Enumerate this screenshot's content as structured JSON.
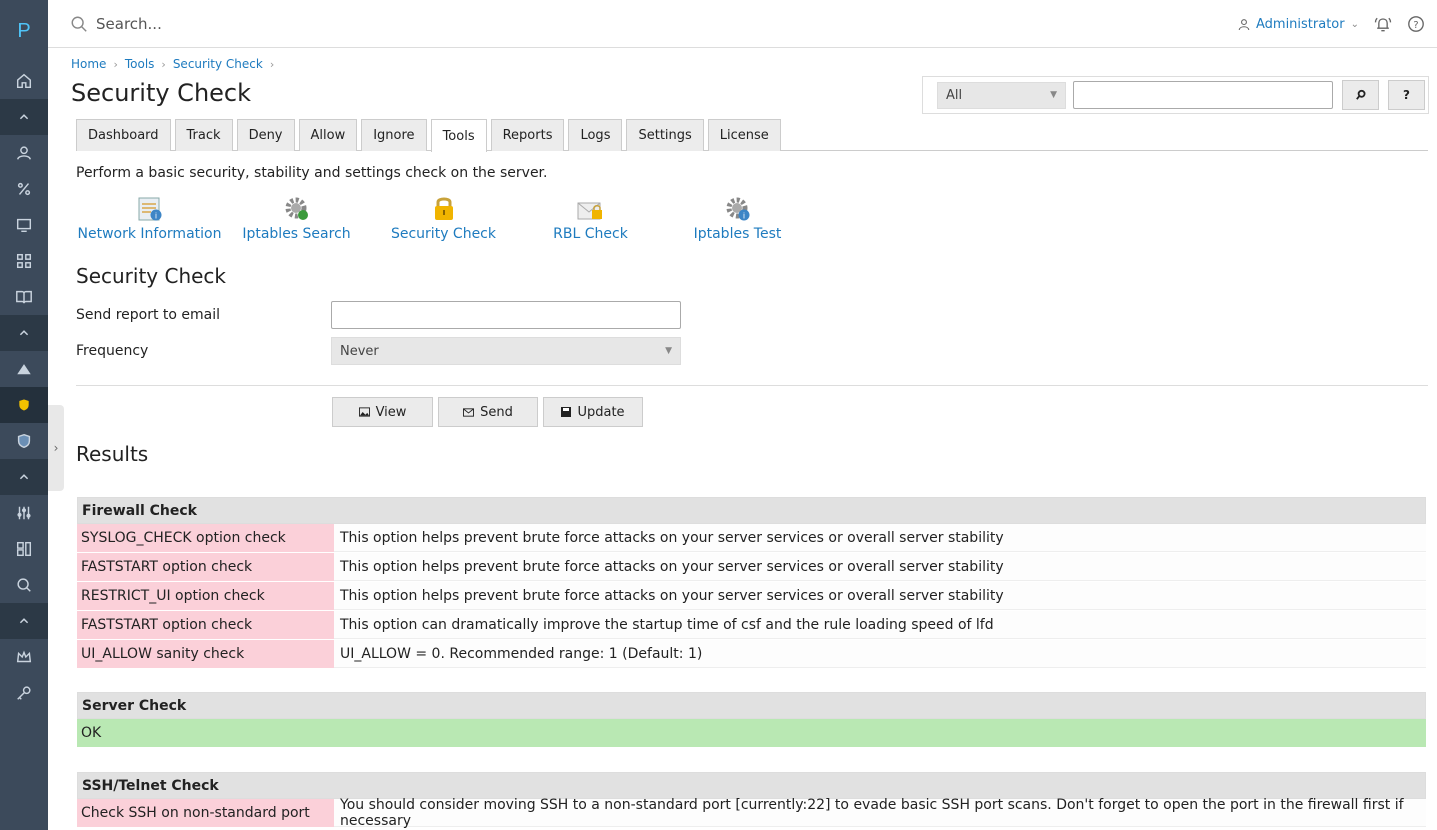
{
  "rail": {
    "logo": "P",
    "items": [
      "home-icon",
      "chevron-up-icon",
      "user-icon",
      "percent-icon",
      "monitor-icon",
      "grid-icon",
      "book-icon",
      "chevron-up-icon",
      "plugin-icon",
      "shield-icon",
      "shield-icon",
      "chevron-up-icon",
      "sliders-icon",
      "layout-icon",
      "search-icon",
      "chevron-up-icon",
      "crown-icon",
      "key-icon"
    ]
  },
  "topbar": {
    "search_placeholder": "Search...",
    "user": "Administrator"
  },
  "breadcrumb": [
    "Home",
    "Tools",
    "Security Check"
  ],
  "page_title": "Security Check",
  "filter": {
    "select_value": "All",
    "help_label": "?"
  },
  "tabs": [
    "Dashboard",
    "Track",
    "Deny",
    "Allow",
    "Ignore",
    "Tools",
    "Reports",
    "Logs",
    "Settings",
    "License"
  ],
  "active_tab": "Tools",
  "description": "Perform a basic security, stability and settings check on the server.",
  "tools": [
    {
      "label": "Network Information",
      "icon": "network-info-icon"
    },
    {
      "label": "Iptables Search",
      "icon": "gear-icon"
    },
    {
      "label": "Security Check",
      "icon": "lock-icon"
    },
    {
      "label": "RBL Check",
      "icon": "mail-lock-icon"
    },
    {
      "label": "Iptables Test",
      "icon": "gear-info-icon"
    }
  ],
  "form": {
    "title": "Security Check",
    "email_label": "Send report to email",
    "email_value": "",
    "frequency_label": "Frequency",
    "frequency_value": "Never",
    "buttons": {
      "view": "View",
      "send": "Send",
      "update": "Update"
    }
  },
  "results": {
    "title": "Results",
    "sections": [
      {
        "name": "Firewall Check",
        "rows": [
          {
            "key": "SYSLOG_CHECK option check",
            "value": "This option helps prevent brute force attacks on your server services or overall server stability"
          },
          {
            "key": "FASTSTART option check",
            "value": "This option helps prevent brute force attacks on your server services or overall server stability"
          },
          {
            "key": "RESTRICT_UI option check",
            "value": "This option helps prevent brute force attacks on your server services or overall server stability"
          },
          {
            "key": "FASTSTART option check",
            "value": "This option can dramatically improve the startup time of csf and the rule loading speed of lfd"
          },
          {
            "key": "UI_ALLOW sanity check",
            "value": "UI_ALLOW = 0. Recommended range: 1 (Default: 1)"
          }
        ]
      },
      {
        "name": "Server Check",
        "ok": "OK"
      },
      {
        "name": "SSH/Telnet Check",
        "rows": [
          {
            "key": "Check SSH on non-standard port",
            "value": "You should consider moving SSH to a non-standard port [currently:22] to evade basic SSH port scans. Don't forget to open the port in the firewall first if necessary"
          }
        ]
      }
    ]
  }
}
